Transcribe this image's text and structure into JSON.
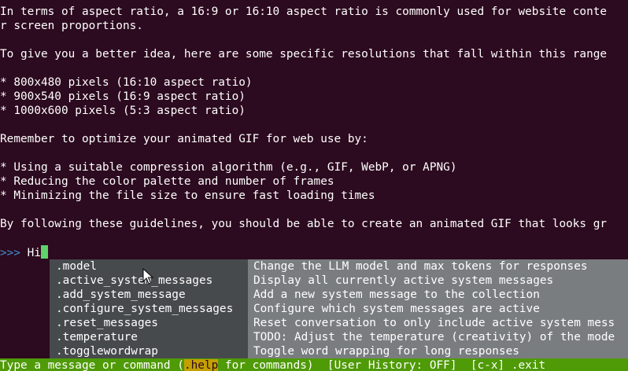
{
  "terminal": {
    "output_lines": [
      "In terms of aspect ratio, a 16:9 or 16:10 aspect ratio is commonly used for website conte",
      "r screen proportions.",
      "",
      "To give you a better idea, here are some specific resolutions that fall within this range",
      "",
      "* 800x480 pixels (16:10 aspect ratio)",
      "* 900x540 pixels (16:9 aspect ratio)",
      "* 1000x600 pixels (5:3 aspect ratio)",
      "",
      "Remember to optimize your animated GIF for web use by:",
      "",
      "* Using a suitable compression algorithm (e.g., GIF, WebP, or APNG)",
      "* Reducing the color palette and number of frames",
      "* Minimizing the file size to ensure fast loading times",
      "",
      "By following these guidelines, you should be able to create an animated GIF that looks gr"
    ],
    "prompt": {
      "symbol": ">>>",
      "input_value": "Hi"
    }
  },
  "completion_menu": {
    "items": [
      {
        "command": ".model",
        "description": "Change the LLM model and max tokens for responses"
      },
      {
        "command": ".active_system_messages",
        "description": "Display all currently active system messages"
      },
      {
        "command": ".add_system_message",
        "description": "Add a new system message to the collection"
      },
      {
        "command": ".configure_system_messages",
        "description": "Configure which system messages are active"
      },
      {
        "command": ".reset_messages",
        "description": "Reset conversation to only include active system mess"
      },
      {
        "command": ".temperature",
        "description": "TODO: Adjust the temperature (creativity) of the mode"
      },
      {
        "command": ".togglewordwrap",
        "description": "Toggle word wrapping for long responses"
      }
    ]
  },
  "bottom_toolbar": {
    "hint_prefix": "Type a message or command (",
    "hint_help": ".help",
    "hint_suffix": " for commands)",
    "history_status": "User History: OFF",
    "exit_key": "[c-x]",
    "exit_label": ".exit"
  },
  "colors": {
    "background": "#2c0a1f",
    "toolbar": "#4f9a07",
    "menu_command_bg": "#474a4d",
    "menu_description_bg": "#7a7d80",
    "cursor": "#5fd36a",
    "prompt_symbol": "#3f8fd0",
    "help_highlight": "#c4a000"
  }
}
